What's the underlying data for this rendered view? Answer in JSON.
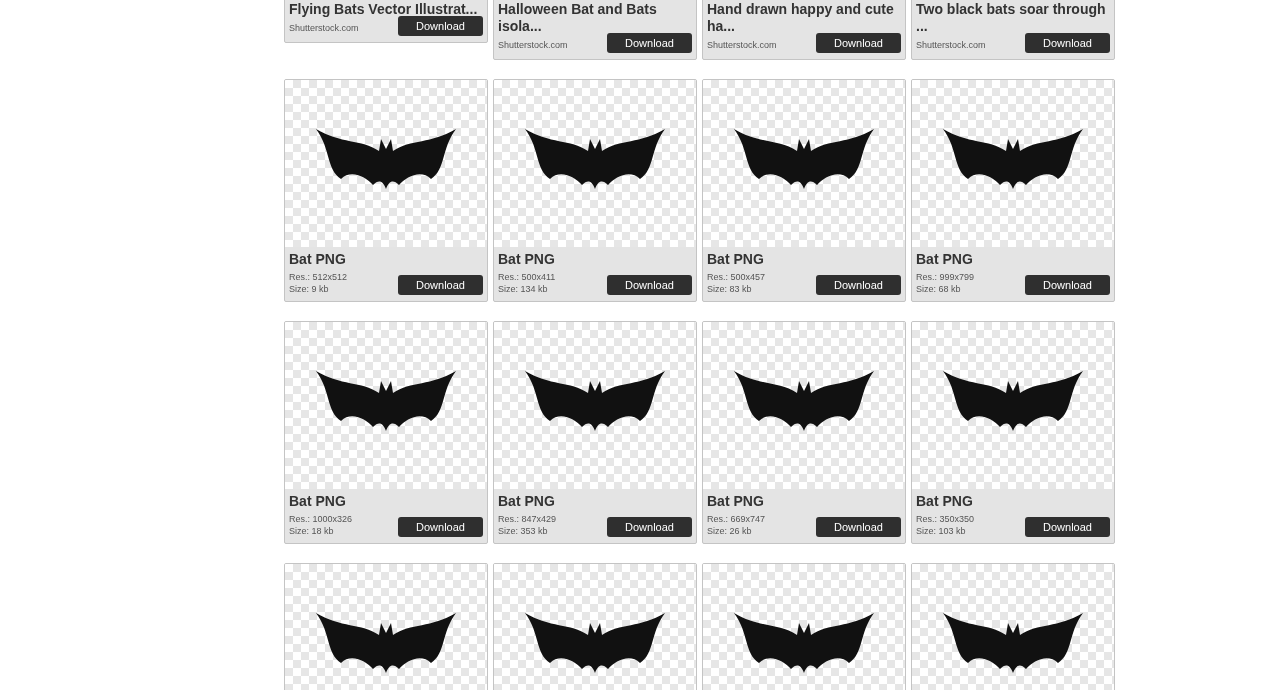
{
  "cards": [
    {
      "kind": "stock",
      "title": "Flying Bats Vector Illustrat...",
      "source": "Shutterstock.com",
      "button": "Download"
    },
    {
      "kind": "stock",
      "title": "Halloween Bat and Bats isola...",
      "source": "Shutterstock.com",
      "button": "Download"
    },
    {
      "kind": "stock",
      "title": "Hand drawn happy and cute ha...",
      "source": "Shutterstock.com",
      "button": "Download"
    },
    {
      "kind": "stock",
      "title": "Two black bats soar through ...",
      "source": "Shutterstock.com",
      "button": "Download"
    },
    {
      "kind": "png",
      "title": "Bat PNG",
      "res": "Res.: 512x512",
      "size": "Size: 9 kb",
      "button": "Download"
    },
    {
      "kind": "png",
      "title": "Bat PNG",
      "res": "Res.: 500x411",
      "size": "Size: 134 kb",
      "button": "Download"
    },
    {
      "kind": "png",
      "title": "Bat PNG",
      "res": "Res.: 500x457",
      "size": "Size: 83 kb",
      "button": "Download"
    },
    {
      "kind": "png",
      "title": "Bat PNG",
      "res": "Res.: 999x799",
      "size": "Size: 68 kb",
      "button": "Download"
    },
    {
      "kind": "png",
      "title": "Bat PNG",
      "res": "Res.: 1000x326",
      "size": "Size: 18 kb",
      "button": "Download"
    },
    {
      "kind": "png",
      "title": "Bat PNG",
      "res": "Res.: 847x429",
      "size": "Size: 353 kb",
      "button": "Download"
    },
    {
      "kind": "png",
      "title": "Bat PNG",
      "res": "Res.: 669x747",
      "size": "Size: 26 kb",
      "button": "Download"
    },
    {
      "kind": "png",
      "title": "Bat PNG",
      "res": "Res.: 350x350",
      "size": "Size: 103 kb",
      "button": "Download"
    },
    {
      "kind": "png"
    },
    {
      "kind": "png"
    },
    {
      "kind": "png"
    },
    {
      "kind": "png"
    }
  ]
}
